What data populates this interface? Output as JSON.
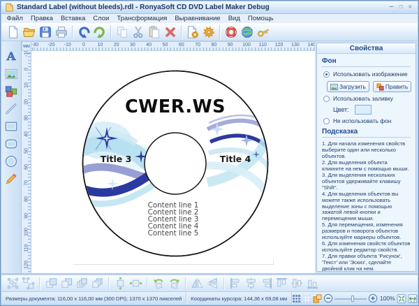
{
  "window": {
    "title": "Standard Label (without bleeds).rdl - RonyaSoft CD DVD Label Maker Debug",
    "buttons": [
      "minimize",
      "maximize",
      "close"
    ]
  },
  "menu": {
    "items": [
      "Файл",
      "Правка",
      "Вставка",
      "Слои",
      "Трансформация",
      "Выравнивание",
      "Вид",
      "Помощь"
    ]
  },
  "toolbar": {
    "groups": [
      [
        "new",
        "open",
        "save",
        "print"
      ],
      [
        "undo",
        "redo"
      ],
      [
        "copy",
        "cut",
        "paste",
        "delete"
      ],
      [
        "page-setup",
        "settings"
      ],
      [
        "help",
        "website",
        "license-key"
      ]
    ]
  },
  "left_tools": [
    "text",
    "image",
    "clipart",
    "line",
    "rectangle",
    "rounded-rectangle",
    "ellipse",
    "pencil"
  ],
  "ruler": {
    "unit": "мм",
    "h": {
      "start": -30,
      "end": 140,
      "step": 10
    },
    "v": {
      "start": -10,
      "end": 120,
      "step": 10
    }
  },
  "label_design": {
    "brand": "CWER.WS",
    "title_left": "Title 3",
    "title_right": "Title 4",
    "content_lines": [
      "Content line 1",
      "Content line 2",
      "Content line 3",
      "Content line 4",
      "Content line 5"
    ]
  },
  "shape_toolbar": {
    "groups": [
      [
        "group",
        "ungroup"
      ],
      [
        "bring-to-front",
        "send-to-back",
        "bring-forward",
        "send-backward"
      ],
      [
        "center-horizontally",
        "center-vertically"
      ],
      [
        "rotate-left",
        "rotate-right"
      ],
      [
        "flip-horizontal",
        "flip-vertical"
      ],
      [
        "align-left",
        "align-center",
        "align-right",
        "align-top",
        "align-middle",
        "align-bottom"
      ]
    ]
  },
  "properties_panel": {
    "title": "Свойства",
    "background_section": {
      "heading": "Фон",
      "options": [
        {
          "label": "Использовать изображение",
          "selected": true
        },
        {
          "label": "Использовать заливку",
          "selected": false
        },
        {
          "label": "Не использовать фон",
          "selected": false
        }
      ],
      "load_button": "Загрузить",
      "edit_button": "Править",
      "color_label": "Цвет:",
      "color_value": "#dceefb"
    },
    "hint_section": {
      "heading": "Подсказка",
      "lines": [
        "1. Для начала изменения свойств выберите один или несколько объектов.",
        "2. Для выделения объекта кликните на нем с помощью мыши.",
        "3. Для выделения нескольких объектов удерживайте клавишу \"Shift\".",
        "4. Для выделения объектов вы можете также использовать выделение зоны с помощью зажатой левой кнопки и перемещения мыши.",
        "5. Для перемещения, изменения размеров и поворота объектов используйте маркеры объектов.",
        "6. Для изменения свойств объектов используйте редактор свойств.",
        "7. Для правки объекта 'Рисунок', 'Текст' или 'Эскиз', сделайте двойной клик на нем."
      ]
    }
  },
  "statusbar": {
    "document_size": "Размеры документа: 116,00 x 116,00 мм (300 DPI); 1370 x 1370 пикселей",
    "cursor": "Координаты курсора: 144,36 x 69,08 мм",
    "zoom": "100%",
    "icons": [
      "grid",
      "grid-light",
      "snap",
      "zoom-out",
      "zoom-slider",
      "zoom-in",
      "fit-page",
      "fit-width"
    ]
  }
}
